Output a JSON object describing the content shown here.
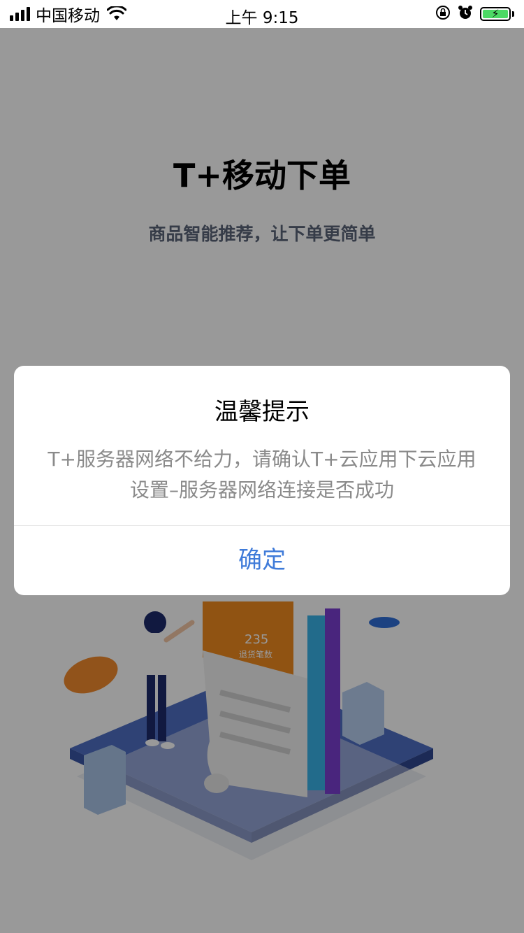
{
  "status_bar": {
    "carrier": "中国移动",
    "time": "上午 9:15",
    "icons": [
      "signal-icon",
      "wifi-icon",
      "orientation-lock-icon",
      "alarm-icon",
      "battery-icon"
    ],
    "battery_color": "#4cd964"
  },
  "app": {
    "title": "T+移动下单",
    "subtitle": "商品智能推荐，让下单更简单",
    "illustration": {
      "card_number": "235",
      "card_label": "退货笔数",
      "card_partial_label": "数"
    }
  },
  "dialog": {
    "title": "温馨提示",
    "message_line1": "T+服务器网络不给力，请确认T+云应用下云应用",
    "message_line2": "设置–服务器网络连接是否成功",
    "confirm_label": "确定",
    "accent_color": "#3f7bd9"
  }
}
